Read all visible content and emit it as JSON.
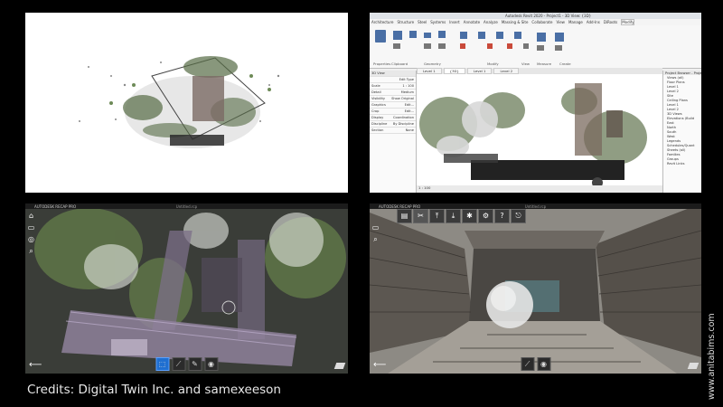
{
  "credits": "Credits: Digital Twin Inc. and samexeeson",
  "side_credit": "www.anitabims.com",
  "revit": {
    "title": "Autodesk Revit 2020 - Project1 - 3D View: {3D}",
    "menus": [
      "Architecture",
      "Structure",
      "Steel",
      "Systems",
      "Insert",
      "Annotate",
      "Analyze",
      "Massing & Site",
      "Collaborate",
      "View",
      "Manage",
      "Add-Ins",
      "DiRoots",
      "Modify"
    ],
    "active_menu": "Modify",
    "groups": [
      "Properties",
      "Clipboard",
      "Geometry",
      "Modify",
      "View",
      "Measure",
      "Create"
    ],
    "tabs": [
      "Level 1",
      "{3D}",
      "Level 1",
      "Level 2"
    ],
    "properties": {
      "type": "3D View",
      "rows": [
        [
          "Scale",
          "1 : 100"
        ],
        [
          "Detail",
          "Medium"
        ],
        [
          "Visibility",
          "Show Original"
        ],
        [
          "Graphics",
          "Edit..."
        ],
        [
          "Crop",
          "Edit..."
        ],
        [
          "Display",
          "Coordination"
        ],
        [
          "Discipline",
          "By Discipline"
        ],
        [
          "Section",
          "None"
        ]
      ],
      "edit_type": "Edit Type"
    },
    "browser": {
      "title": "Project Browser - Project1",
      "items": [
        "Views (all)",
        "Floor Plans",
        "Level 1",
        "Level 2",
        "Site",
        "Ceiling Plans",
        "Level 1",
        "Level 2",
        "3D Views",
        "Elevations (Build",
        "East",
        "North",
        "South",
        "West",
        "Legends",
        "Schedules/Quant",
        "Sheets (all)",
        "Families",
        "Groups",
        "Revit Links"
      ]
    },
    "status": "1 : 100"
  },
  "recap1": {
    "app": "AUTODESK  RECAP PRO",
    "file": "Untitled.rcp"
  },
  "recap2": {
    "app": "AUTODESK  RECAP PRO",
    "file": "Untitled.rcp"
  }
}
